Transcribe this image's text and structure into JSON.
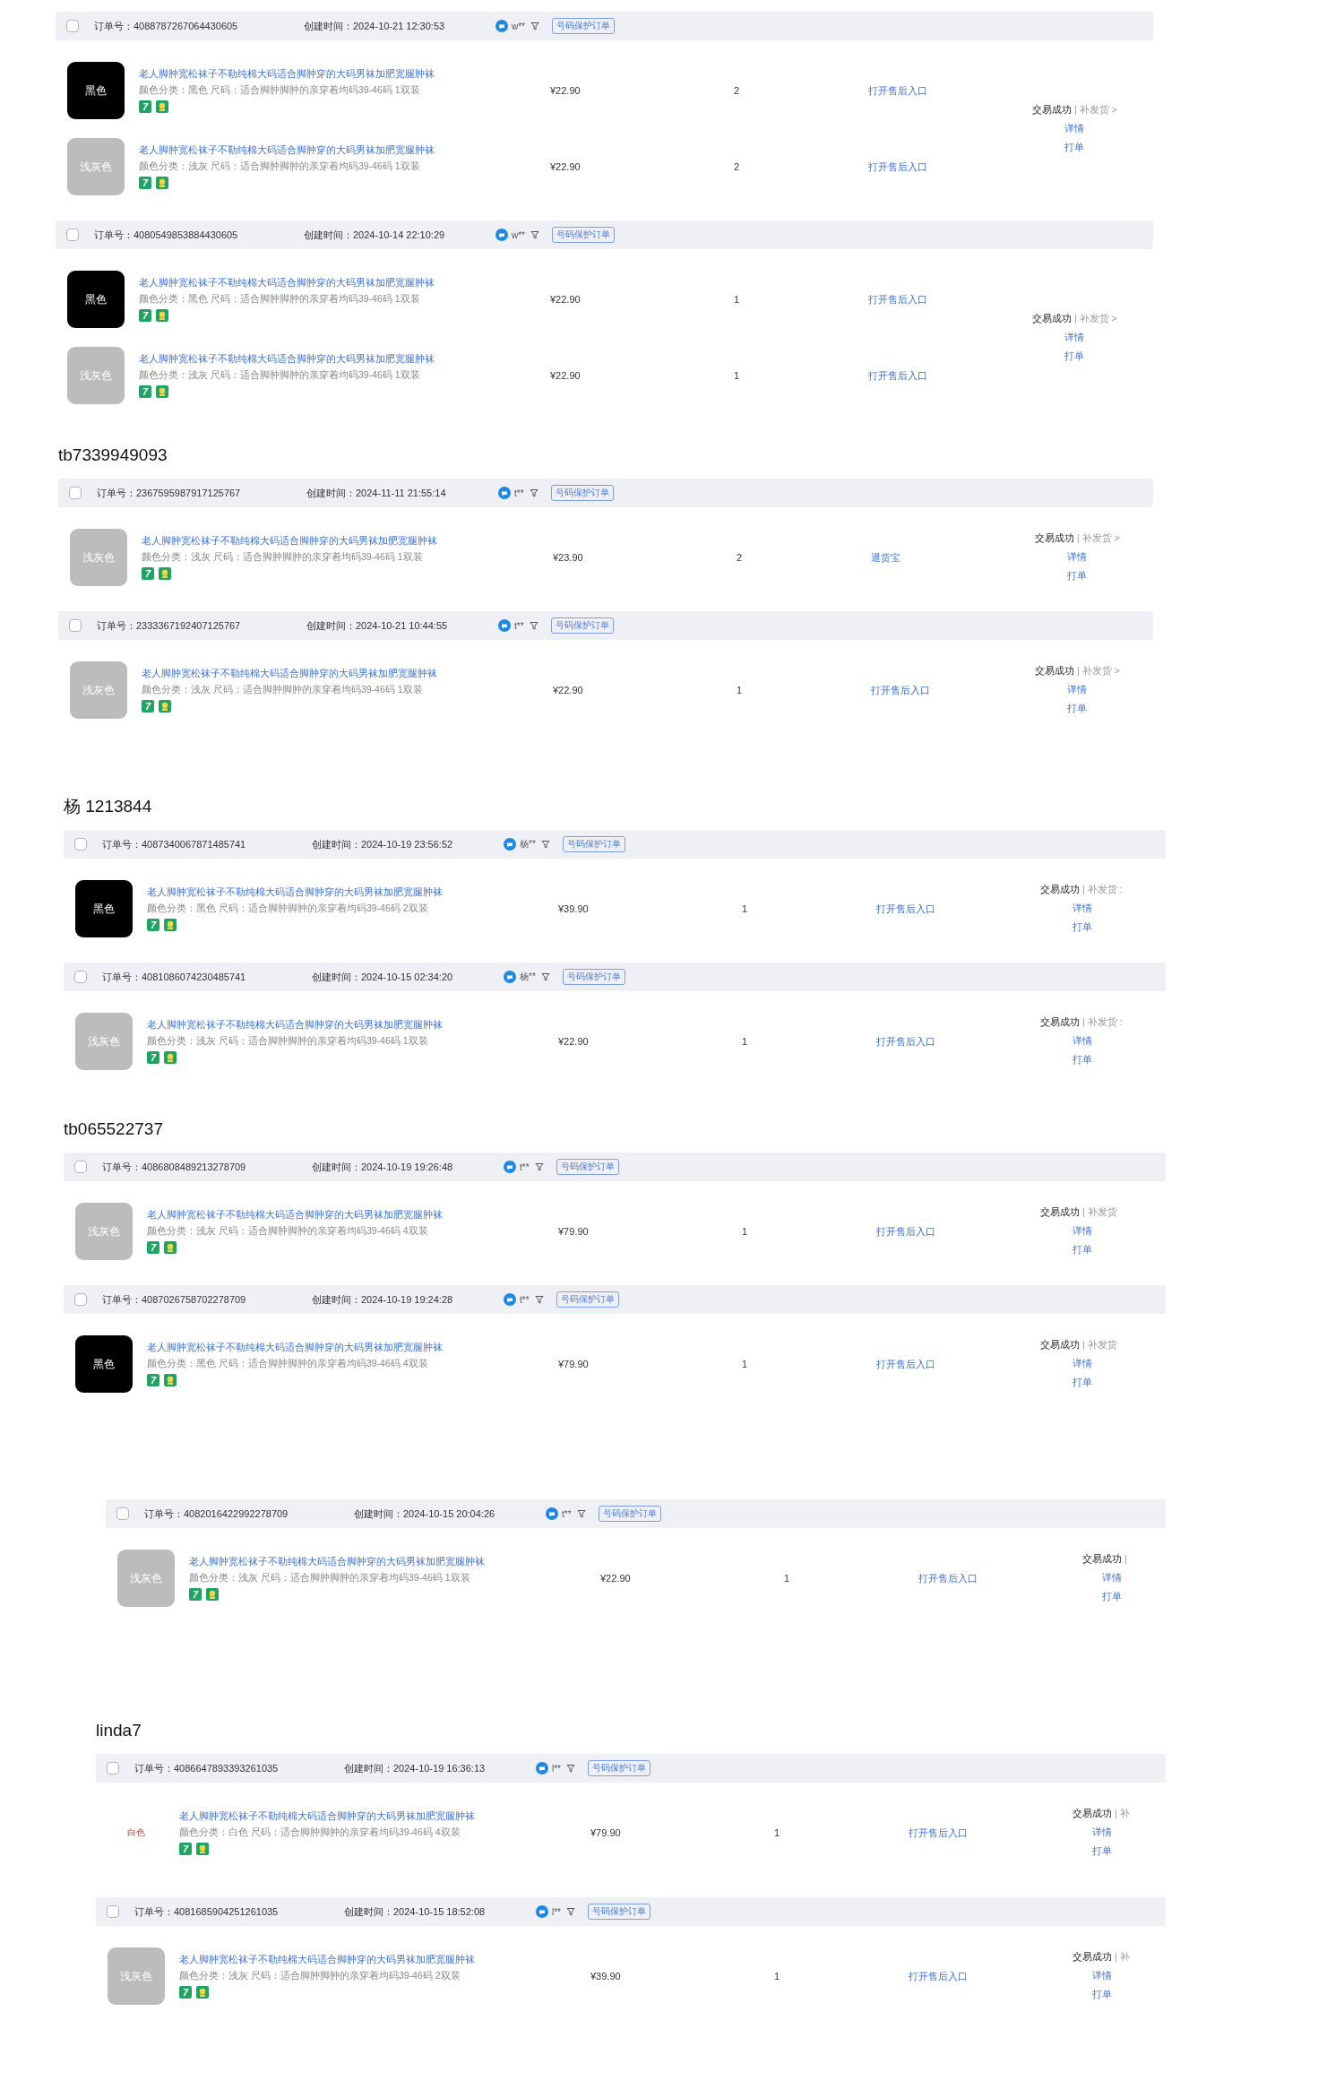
{
  "sections": [
    {
      "orders": [
        {
          "checked": false,
          "order_label": "订单号：",
          "order_no": "4088787267064430605",
          "time_label": "创建时间：",
          "created": "2024-10-21 12:30:53",
          "buyer": "w**",
          "tag": "号码保护订单",
          "status": "交易成功",
          "reissue": "| 补发货 >",
          "detail": "详情",
          "print": "打单",
          "items": [
            {
              "kind": "black",
              "swatch_label": "黑色",
              "title": "老人脚肿宽松袜子不勒纯棉大码适合脚肿穿的大码男袜加肥宽腿肿袜",
              "spec": "颜色分类：黑色  尺码：适合脚肿脚肿的亲穿着均码39-46码 1双装",
              "badge": "7",
              "price": "¥22.90",
              "qty": "2",
              "after_sale": "打开售后入口"
            },
            {
              "kind": "gray",
              "swatch_label": "浅灰色",
              "title": "老人脚肿宽松袜子不勒纯棉大码适合脚肿穿的大码男袜加肥宽腿肿袜",
              "spec": "颜色分类：浅灰  尺码：适合脚肿脚肿的亲穿着均码39-46码 1双装",
              "badge": "7",
              "price": "¥22.90",
              "qty": "2",
              "after_sale": "打开售后入口"
            }
          ]
        },
        {
          "checked": false,
          "order_label": "订单号：",
          "order_no": "4080549853884430605",
          "time_label": "创建时间：",
          "created": "2024-10-14 22:10:29",
          "buyer": "w**",
          "tag": "号码保护订单",
          "status": "交易成功",
          "reissue": "| 补发货 >",
          "detail": "详情",
          "print": "打单",
          "items": [
            {
              "kind": "black",
              "swatch_label": "黑色",
              "title": "老人脚肿宽松袜子不勒纯棉大码适合脚肿穿的大码男袜加肥宽腿肿袜",
              "spec": "颜色分类：黑色  尺码：适合脚肿脚肿的亲穿着均码39-46码 1双装",
              "badge": "7",
              "price": "¥22.90",
              "qty": "1",
              "after_sale": "打开售后入口"
            },
            {
              "kind": "gray",
              "swatch_label": "浅灰色",
              "title": "老人脚肿宽松袜子不勒纯棉大码适合脚肿穿的大码男袜加肥宽腿肿袜",
              "spec": "颜色分类：浅灰  尺码：适合脚肿脚肿的亲穿着均码39-46码 1双装",
              "badge": "7",
              "price": "¥22.90",
              "qty": "1",
              "after_sale": "打开售后入口"
            }
          ]
        }
      ]
    },
    {
      "buyer_name": "tb7339949093",
      "orders": [
        {
          "checked": false,
          "order_label": "订单号：",
          "order_no": "2367595987917125767",
          "time_label": "创建时间：",
          "created": "2024-11-11 21:55:14",
          "buyer": "t**",
          "tag": "号码保护订单",
          "status": "交易成功",
          "reissue": "| 补发货 >",
          "detail": "详情",
          "print": "打单",
          "items": [
            {
              "kind": "gray",
              "swatch_label": "浅灰色",
              "title": "老人脚肿宽松袜子不勒纯棉大码适合脚肿穿的大码男袜加肥宽腿肿袜",
              "spec": "颜色分类：浅灰  尺码：适合脚肿脚肿的亲穿着均码39-46码 1双装",
              "badge": "7",
              "price": "¥23.90",
              "qty": "2",
              "after_sale": "退货宝"
            }
          ]
        },
        {
          "checked": false,
          "order_label": "订单号：",
          "order_no": "2333367192407125767",
          "time_label": "创建时间：",
          "created": "2024-10-21 10:44:55",
          "buyer": "t**",
          "tag": "号码保护订单",
          "status": "交易成功",
          "reissue": "| 补发货 >",
          "detail": "详情",
          "print": "打单",
          "items": [
            {
              "kind": "gray",
              "swatch_label": "浅灰色",
              "title": "老人脚肿宽松袜子不勒纯棉大码适合脚肿穿的大码男袜加肥宽腿肿袜",
              "spec": "颜色分类：浅灰  尺码：适合脚肿脚肿的亲穿着均码39-46码 1双装",
              "badge": "7",
              "price": "¥22.90",
              "qty": "1",
              "after_sale": "打开售后入口"
            }
          ]
        }
      ]
    },
    {
      "buyer_name": "杨 1213844",
      "orders": [
        {
          "checked": false,
          "order_label": "订单号：",
          "order_no": "4087340067871485741",
          "time_label": "创建时间：",
          "created": "2024-10-19 23:56:52",
          "buyer": "杨**",
          "tag": "号码保护订单",
          "status": "交易成功",
          "reissue": "| 补发货 :",
          "detail": "详情",
          "print": "打单",
          "items": [
            {
              "kind": "black",
              "swatch_label": "黑色",
              "title": "老人脚肿宽松袜子不勒纯棉大码适合脚肿穿的大码男袜加肥宽腿肿袜",
              "spec": "颜色分类：黑色  尺码：适合脚肿脚肿的亲穿着均码39-46码 2双装",
              "badge": "7",
              "price": "¥39.90",
              "qty": "1",
              "after_sale": "打开售后入口"
            }
          ]
        },
        {
          "checked": false,
          "order_label": "订单号：",
          "order_no": "4081086074230485741",
          "time_label": "创建时间：",
          "created": "2024-10-15 02:34:20",
          "buyer": "杨**",
          "tag": "号码保护订单",
          "status": "交易成功",
          "reissue": "| 补发货 :",
          "detail": "详情",
          "print": "打单",
          "items": [
            {
              "kind": "gray",
              "swatch_label": "浅灰色",
              "title": "老人脚肿宽松袜子不勒纯棉大码适合脚肿穿的大码男袜加肥宽腿肿袜",
              "spec": "颜色分类：浅灰  尺码：适合脚肿脚肿的亲穿着均码39-46码 1双装",
              "badge": "7",
              "price": "¥22.90",
              "qty": "1",
              "after_sale": "打开售后入口"
            }
          ]
        }
      ]
    },
    {
      "buyer_name": "tb065522737",
      "orders": [
        {
          "checked": false,
          "order_label": "订单号：",
          "order_no": "4086808489213278709",
          "time_label": "创建时间：",
          "created": "2024-10-19 19:26:48",
          "buyer": "t**",
          "tag": "号码保护订单",
          "status": "交易成功",
          "reissue": "| 补发货",
          "detail": "详情",
          "print": "打单",
          "items": [
            {
              "kind": "gray",
              "swatch_label": "浅灰色",
              "title": "老人脚肿宽松袜子不勒纯棉大码适合脚肿穿的大码男袜加肥宽腿肿袜",
              "spec": "颜色分类：浅灰  尺码：适合脚肿脚肿的亲穿着均码39-46码 4双装",
              "badge": "7",
              "price": "¥79.90",
              "qty": "1",
              "after_sale": "打开售后入口"
            }
          ]
        },
        {
          "checked": false,
          "order_label": "订单号：",
          "order_no": "4087026758702278709",
          "time_label": "创建时间：",
          "created": "2024-10-19 19:24:28",
          "buyer": "t**",
          "tag": "号码保护订单",
          "status": "交易成功",
          "reissue": "| 补发货",
          "detail": "详情",
          "print": "打单",
          "items": [
            {
              "kind": "black",
              "swatch_label": "黑色",
              "title": "老人脚肿宽松袜子不勒纯棉大码适合脚肿穿的大码男袜加肥宽腿肿袜",
              "spec": "颜色分类：黑色  尺码：适合脚肿脚肿的亲穿着均码39-46码 4双装",
              "badge": "7",
              "price": "¥79.90",
              "qty": "1",
              "after_sale": "打开售后入口"
            }
          ]
        }
      ]
    },
    {
      "orders": [
        {
          "checked": false,
          "order_label": "订单号：",
          "order_no": "4082016422992278709",
          "time_label": "创建时间：",
          "created": "2024-10-15 20:04:26",
          "buyer": "t**",
          "tag": "号码保护订单",
          "status": "交易成功",
          "reissue": "|",
          "detail": "详情",
          "print": "打单",
          "items": [
            {
              "kind": "gray",
              "swatch_label": "浅灰色",
              "title": "老人脚肿宽松袜子不勒纯棉大码适合脚肿穿的大码男袜加肥宽腿肿袜",
              "spec": "颜色分类：浅灰  尺码：适合脚肿脚肿的亲穿着均码39-46码 1双装",
              "badge": "7",
              "price": "¥22.90",
              "qty": "1",
              "after_sale": "打开售后入口"
            }
          ]
        }
      ]
    },
    {
      "buyer_name": "linda7",
      "orders": [
        {
          "checked": false,
          "order_label": "订单号：",
          "order_no": "4086647893393261035",
          "time_label": "创建时间：",
          "created": "2024-10-19 16:36:13",
          "buyer": "l**",
          "tag": "号码保护订单",
          "status": "交易成功",
          "reissue": "| 补",
          "detail": "详情",
          "print": "打单",
          "items": [
            {
              "kind": "white",
              "swatch_label": "白色",
              "title": "老人脚肿宽松袜子不勒纯棉大码适合脚肿穿的大码男袜加肥宽腿肿袜",
              "spec": "颜色分类：白色  尺码：适合脚肿脚肿的亲穿着均码39-46码 4双装",
              "badge": "7",
              "price": "¥79.90",
              "qty": "1",
              "after_sale": "打开售后入口"
            }
          ]
        },
        {
          "checked": false,
          "order_label": "订单号：",
          "order_no": "4081685904251261035",
          "time_label": "创建时间：",
          "created": "2024-10-15 18:52:08",
          "buyer": "l**",
          "tag": "号码保护订单",
          "status": "交易成功",
          "reissue": "| 补",
          "detail": "详情",
          "print": "打单",
          "items": [
            {
              "kind": "gray",
              "swatch_label": "浅灰色",
              "title": "老人脚肿宽松袜子不勒纯棉大码适合脚肿穿的大码男袜加肥宽腿肿袜",
              "spec": "颜色分类：浅灰  尺码：适合脚肿脚肿的亲穿着均码39-46码 2双装",
              "badge": "7",
              "price": "¥39.90",
              "qty": "1",
              "after_sale": "打开售后入口"
            }
          ]
        }
      ]
    }
  ]
}
